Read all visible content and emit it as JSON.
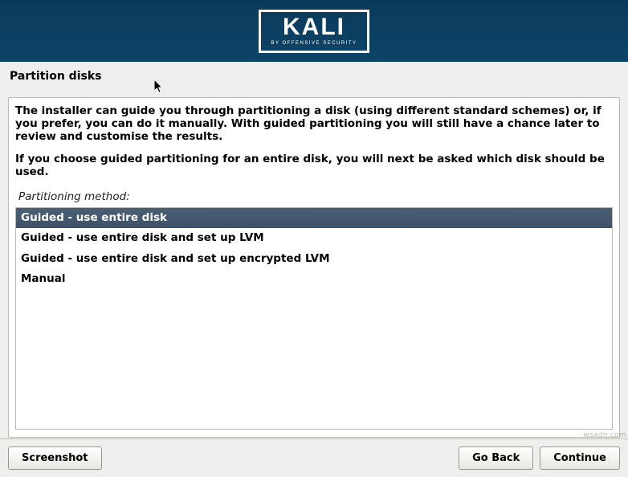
{
  "header": {
    "logo_main": "KALI",
    "logo_sub": "BY OFFENSIVE SECURITY"
  },
  "page_title": "Partition disks",
  "instructions": {
    "p1": "The installer can guide you through partitioning a disk (using different standard schemes) or, if you prefer, you can do it manually. With guided partitioning you will still have a chance later to review and customise the results.",
    "p2": "If you choose guided partitioning for an entire disk, you will next be asked which disk should be used."
  },
  "method_label": "Partitioning method:",
  "options": [
    {
      "label": "Guided - use entire disk",
      "selected": true
    },
    {
      "label": "Guided - use entire disk and set up LVM",
      "selected": false
    },
    {
      "label": "Guided - use entire disk and set up encrypted LVM",
      "selected": false
    },
    {
      "label": "Manual",
      "selected": false
    }
  ],
  "buttons": {
    "screenshot": "Screenshot",
    "go_back": "Go Back",
    "continue": "Continue"
  },
  "watermark": "wsxdn.com"
}
